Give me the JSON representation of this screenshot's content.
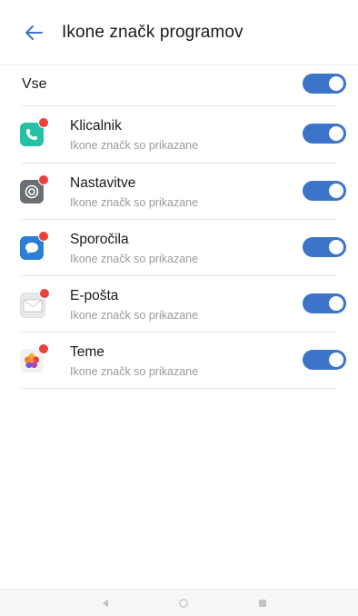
{
  "header": {
    "title": "Ikone značk programov",
    "back_icon": "arrow-left-icon"
  },
  "all_toggle": {
    "label": "Vse",
    "enabled": true
  },
  "apps": [
    {
      "name": "Klicalnik",
      "subtitle": "Ikone značk so prikazane",
      "icon": "phone-icon",
      "icon_color": "#26c0a4",
      "enabled": true
    },
    {
      "name": "Nastavitve",
      "subtitle": "Ikone značk so prikazane",
      "icon": "settings-gear-icon",
      "icon_color": "#6b6f75",
      "enabled": true
    },
    {
      "name": "Sporočila",
      "subtitle": "Ikone značk so prikazane",
      "icon": "message-bubble-icon",
      "icon_color": "#2c7fd6",
      "enabled": true
    },
    {
      "name": "E-pošta",
      "subtitle": "Ikone značk so prikazane",
      "icon": "envelope-icon",
      "icon_color": "#e9e9e9",
      "enabled": true
    },
    {
      "name": "Teme",
      "subtitle": "Ikone značk so prikazane",
      "icon": "theme-palette-icon",
      "icon_color": "#f2f2f2",
      "enabled": true
    }
  ],
  "colors": {
    "accent": "#3b74c9",
    "toggle_on": "#3b74c9",
    "badge": "#e8423a",
    "text_primary": "#1a1a1a",
    "text_secondary": "#9a9a9a",
    "divider": "#e6e6e6"
  },
  "nav_bar": {
    "buttons": [
      "back-triangle-icon",
      "home-circle-icon",
      "recents-square-icon"
    ]
  }
}
